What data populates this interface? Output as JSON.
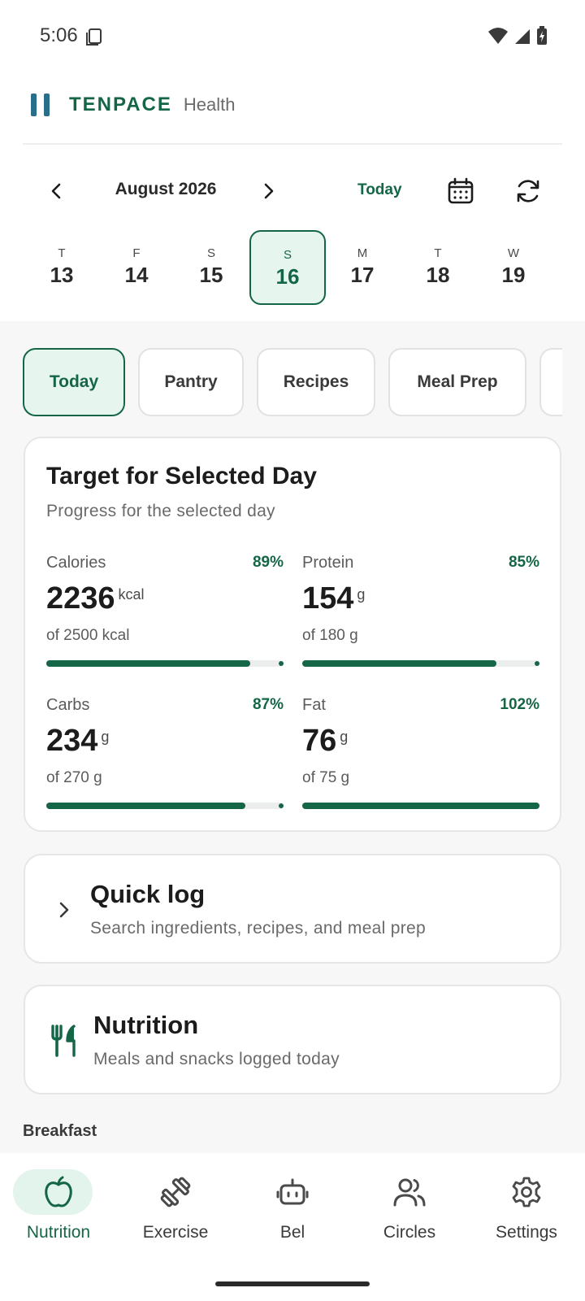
{
  "status": {
    "time": "5:06"
  },
  "brand": {
    "name": "TENPACE",
    "sub": "Health"
  },
  "calendar": {
    "month": "August 2026",
    "today_label": "Today",
    "days": [
      {
        "dow": "T",
        "num": "13"
      },
      {
        "dow": "F",
        "num": "14"
      },
      {
        "dow": "S",
        "num": "15"
      },
      {
        "dow": "S",
        "num": "16",
        "selected": true
      },
      {
        "dow": "M",
        "num": "17"
      },
      {
        "dow": "T",
        "num": "18"
      },
      {
        "dow": "W",
        "num": "19"
      }
    ]
  },
  "tabs": [
    "Today",
    "Pantry",
    "Recipes",
    "Meal Prep"
  ],
  "targets": {
    "title": "Target for Selected Day",
    "subtitle": "Progress for the selected day",
    "metrics": [
      {
        "name": "Calories",
        "pct": "89%",
        "value": "2236",
        "unit": "kcal",
        "of": "of 2500 kcal",
        "progress": 0.89
      },
      {
        "name": "Protein",
        "pct": "85%",
        "value": "154",
        "unit": "g",
        "of": "of 180 g",
        "progress": 0.85
      },
      {
        "name": "Carbs",
        "pct": "87%",
        "value": "234",
        "unit": "g",
        "of": "of 270 g",
        "progress": 0.87
      },
      {
        "name": "Fat",
        "pct": "102%",
        "value": "76",
        "unit": "g",
        "of": "of 75 g",
        "progress": 1.0
      }
    ]
  },
  "quick_log": {
    "title": "Quick log",
    "subtitle": "Search ingredients, recipes, and meal prep"
  },
  "nutrition": {
    "title": "Nutrition",
    "subtitle": "Meals and snacks logged today"
  },
  "section": {
    "breakfast": "Breakfast"
  },
  "bottom_nav": [
    {
      "label": "Nutrition",
      "icon": "apple-icon",
      "active": true
    },
    {
      "label": "Exercise",
      "icon": "dumbbell-icon"
    },
    {
      "label": "Bel",
      "icon": "robot-icon"
    },
    {
      "label": "Circles",
      "icon": "people-icon"
    },
    {
      "label": "Settings",
      "icon": "gear-icon"
    }
  ],
  "colors": {
    "accent": "#156646",
    "accent_light": "#e6f6ef",
    "brand_mark": "#2a6f8a"
  }
}
